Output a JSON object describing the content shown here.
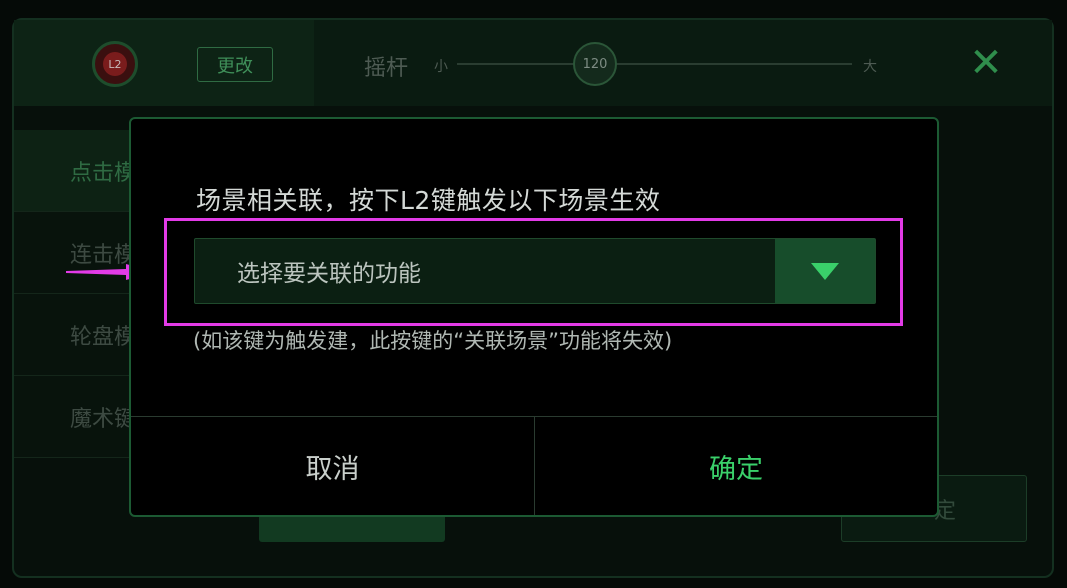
{
  "topbar": {
    "badge_label": "L2",
    "change_label": "更改",
    "joystick_label": "摇杆",
    "slider_small": "小",
    "slider_large": "大",
    "slider_value": "120",
    "close_symbol": "✕"
  },
  "sidebar": {
    "items": [
      {
        "label": "点击模"
      },
      {
        "label": "连击模"
      },
      {
        "label": "轮盘模"
      },
      {
        "label": "魔术键"
      }
    ]
  },
  "background": {
    "right_button_label": "定"
  },
  "modal": {
    "title": "场景相关联，按下L2键触发以下场景生效",
    "select_placeholder": "选择要关联的功能",
    "note": "(如该键为触发建，此按键的“关联场景”功能将失效)",
    "cancel_label": "取消",
    "ok_label": "确定"
  },
  "colors": {
    "accent": "#3ad06a",
    "highlight": "#e23be7",
    "modal_border": "#1c5a33"
  },
  "icons": {
    "close": "close-icon",
    "dropdown": "triangle-down-icon",
    "pointer": "arrow-right-icon"
  }
}
